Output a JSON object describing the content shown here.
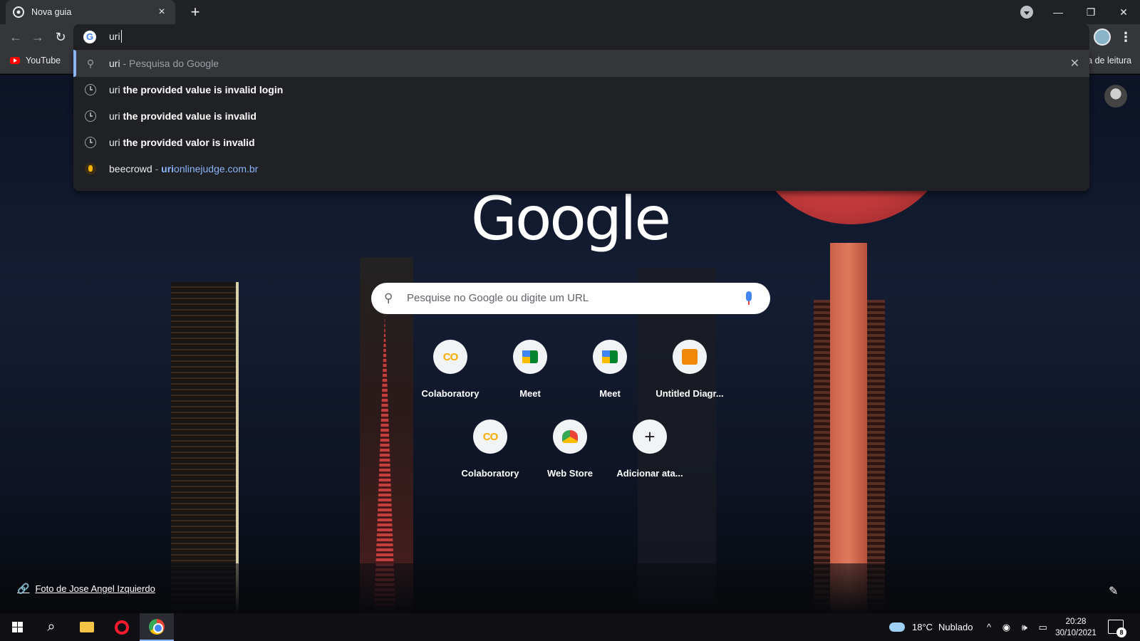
{
  "window": {
    "tab_title": "Nova guia",
    "tab_close_icon": "×",
    "new_tab_icon": "+",
    "minimize_icon": "—",
    "restore_icon": "❐",
    "close_icon": "✕"
  },
  "toolbar": {
    "back_icon": "←",
    "forward_icon": "→",
    "reload_icon": "↻",
    "menu_icon": "⋮"
  },
  "omnibox": {
    "g_icon": "G",
    "input_value": "uri"
  },
  "suggestions": [
    {
      "icon": "search-icon",
      "prefix": "uri",
      "bold": "",
      "suffix": " - Pesquisa do Google"
    },
    {
      "icon": "history-icon",
      "prefix": "uri",
      "bold": " the provided value is invalid login",
      "suffix": ""
    },
    {
      "icon": "history-icon",
      "prefix": "uri",
      "bold": " the provided value is invalid",
      "suffix": ""
    },
    {
      "icon": "history-icon",
      "prefix": "uri",
      "bold": " the provided valor is invalid",
      "suffix": ""
    },
    {
      "icon": "beecrowd-icon",
      "prefix": "beecrowd",
      "sep": " - ",
      "link_bold": "uri",
      "link_rest": "onlinejudge.com.br"
    }
  ],
  "suggestion_remove_icon": "✕",
  "bookmarks": {
    "youtube": "YouTube",
    "reading_list": "a de leitura"
  },
  "ntp": {
    "logo": "Google",
    "search_placeholder": "Pesquise no Google ou digite um URL",
    "search_icon": "🔍",
    "shortcuts_row1": [
      {
        "label": "Colaboratory",
        "icon": "CO"
      },
      {
        "label": "Meet",
        "icon": ""
      },
      {
        "label": "Meet",
        "icon": ""
      },
      {
        "label": "Untitled Diagr...",
        "icon": ""
      }
    ],
    "shortcuts_row2": [
      {
        "label": "Colaboratory",
        "icon": "CO"
      },
      {
        "label": "Web Store",
        "icon": ""
      },
      {
        "label": "Adicionar ata...",
        "icon": "+"
      }
    ],
    "photo_credit": "Foto de Jose Angel Izquierdo",
    "link_icon": "🔗",
    "edit_icon": "✎"
  },
  "taskbar": {
    "search_icon": "⌕",
    "temperature": "18°C",
    "weather": "Nublado",
    "tray_icons": "^ ◉ 🕪 ▭",
    "time": "20:28",
    "date": "30/10/2021",
    "notification_count": "8"
  }
}
